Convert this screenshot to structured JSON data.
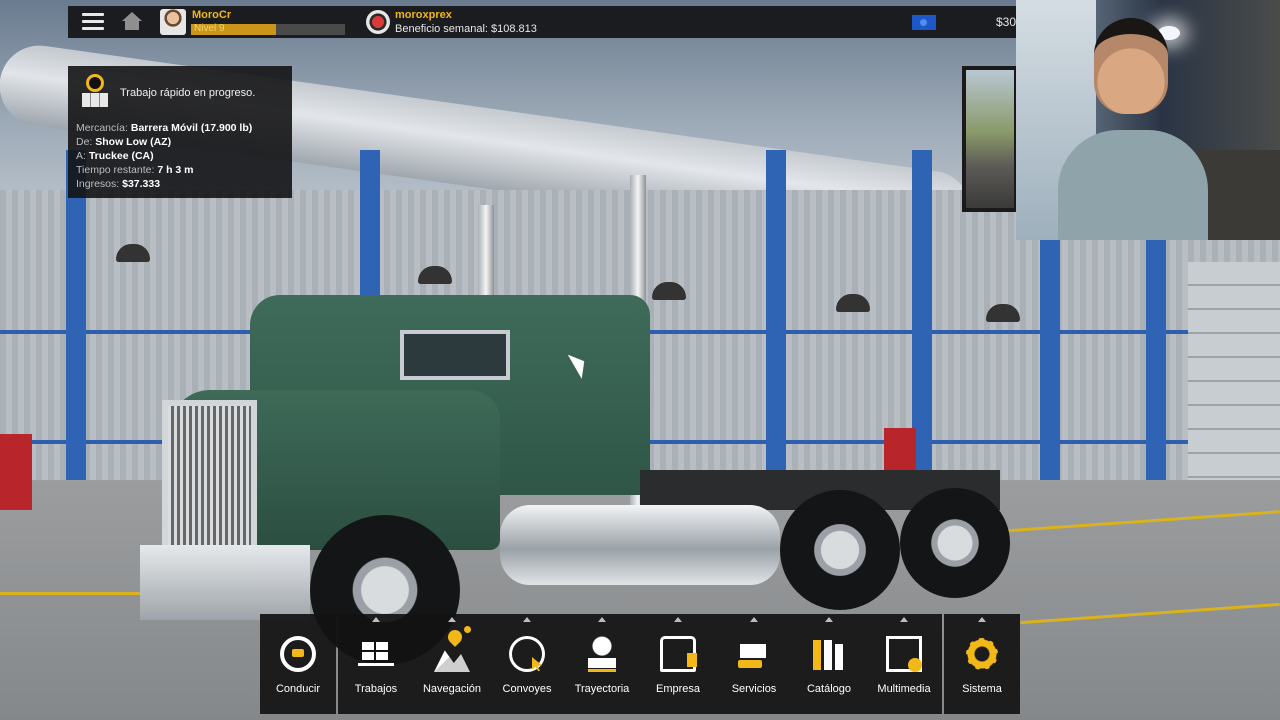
{
  "topbar": {
    "user_name": "MoroCr",
    "level_label": "Nivel 9",
    "level_progress": 0.55,
    "company_name": "moroxprex",
    "weekly_profit": "Beneficio semanal: $108.813",
    "money": "$30",
    "icons": [
      "menu-icon",
      "home-icon",
      "avatar",
      "company-logo-icon",
      "flag-icon"
    ]
  },
  "job": {
    "title": "Trabajo rápido en progreso.",
    "lines": [
      {
        "key": "Mercancía:",
        "value": "Barrera Móvil (17.900 lb)"
      },
      {
        "key": "De:",
        "value": "Show Low (AZ)"
      },
      {
        "key": "A:",
        "value": "Truckee (CA)"
      },
      {
        "key": "Tiempo restante:",
        "value": "7 h 3 m"
      },
      {
        "key": "Ingresos:",
        "value": "$37.333"
      }
    ]
  },
  "menu": {
    "items": [
      {
        "label": "Conducir",
        "icon": "steering-wheel-icon"
      },
      {
        "label": "Trabajos",
        "icon": "cargo-boxes-icon"
      },
      {
        "label": "Navegación",
        "icon": "map-icon",
        "notification": true
      },
      {
        "label": "Convoyes",
        "icon": "globe-cursor-icon"
      },
      {
        "label": "Trayectoria",
        "icon": "driver-profile-icon"
      },
      {
        "label": "Empresa",
        "icon": "company-truck-icon"
      },
      {
        "label": "Servicios",
        "icon": "services-icon"
      },
      {
        "label": "Catálogo",
        "icon": "catalog-books-icon"
      },
      {
        "label": "Multimedia",
        "icon": "multimedia-icon"
      },
      {
        "label": "Sistema",
        "icon": "gear-icon"
      }
    ]
  },
  "colors": {
    "accent": "#f2b818",
    "panel": "#141416",
    "truck": "#3f6b5a",
    "steel_columns": "#2f63b4"
  }
}
